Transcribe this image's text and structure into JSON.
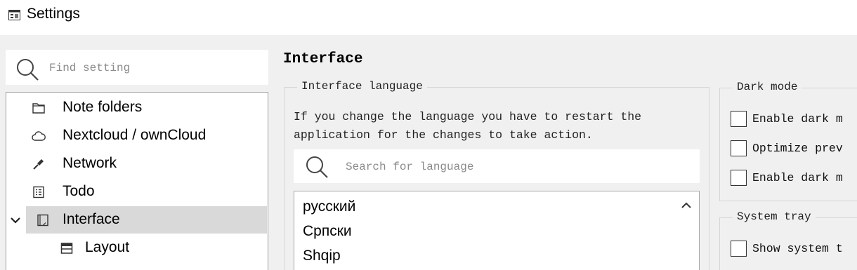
{
  "window": {
    "title": "Settings"
  },
  "sidebar": {
    "search_placeholder": "Find setting",
    "items": [
      {
        "label": "Note folders"
      },
      {
        "label": "Nextcloud / ownCloud"
      },
      {
        "label": "Network"
      },
      {
        "label": "Todo"
      },
      {
        "label": "Interface",
        "selected": true,
        "expanded": true
      },
      {
        "label": "Layout"
      }
    ]
  },
  "main": {
    "heading": "Interface",
    "language_group": {
      "title": "Interface language",
      "description_line1": "If you change the language you have to restart the",
      "description_line2": "application for the changes to take action.",
      "search_placeholder": "Search for language",
      "languages": [
        "русский",
        "Српски",
        "Shqip"
      ]
    },
    "dark_mode_group": {
      "title": "Dark mode",
      "options": [
        "Enable dark m",
        "Optimize prev",
        "Enable dark m"
      ]
    },
    "system_tray_group": {
      "title": "System tray",
      "options": [
        "Show system t"
      ]
    }
  },
  "colors": {
    "background": "#f0f0f0",
    "selection": "#d9d9d9",
    "border": "#a0a0a0"
  }
}
